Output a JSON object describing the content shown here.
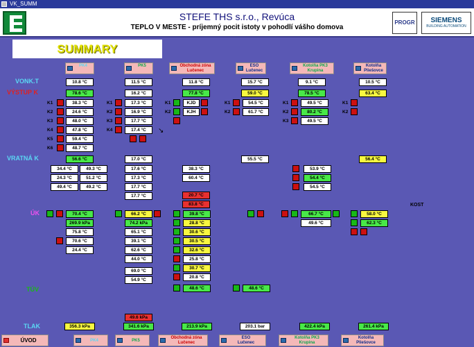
{
  "window": {
    "title": "VK_SUMM"
  },
  "header": {
    "company": "STEFE THS s.r.o., Revúca",
    "slogan": "TEPLO V MESTE - príjemný pocit istoty v pohodlí vášho domova",
    "progr": "PROGR",
    "siemens": "SIEMENS",
    "siemens_sub": "BUILDING AUTOMATION"
  },
  "summary": {
    "title": "SUMMARY"
  },
  "columns": [
    {
      "label": "PK4",
      "color": "#5ad8f4"
    },
    {
      "label": "PK5",
      "color": "#0aa84a"
    },
    {
      "label": "Obchodná zóna\nLučenec",
      "color": "#cc0000"
    },
    {
      "label": "ESO\nLučenec",
      "color": "#0a2a8a"
    },
    {
      "label": "Kotolňa PK3\nKrupina",
      "color": "#0aa84a"
    },
    {
      "label": "Kotolňa\nPliešovce",
      "color": "#0a2a8a"
    }
  ],
  "row_labels": {
    "vonk": "VONK.T",
    "vystup": "VÝSTUP K",
    "vratna": "VRATNÁ K",
    "uk": "ÚK",
    "tuv": "TÚV",
    "tlak": "TLAK"
  },
  "labels": {
    "k1": "K1",
    "k2": "K2",
    "k3": "K3",
    "k4": "K4",
    "k5": "K5",
    "k6": "K6",
    "kost": "KOST"
  },
  "values": {
    "vonk": [
      "10.8 °C",
      "11.5 °C",
      "11.8 °C",
      "15.7 °C",
      "9.1 °C",
      "10.5 °C"
    ],
    "vystup": [
      "78.6 °C",
      "16.2 °C",
      "77.8 °C",
      "59.0 °C",
      "78.5 °C",
      "63.4 °C"
    ],
    "pk4_k": [
      "38.3 °C",
      "24.6 °C",
      "48.0 °C",
      "47.8 °C",
      "59.4 °C",
      "48.7 °C"
    ],
    "pk5_k": [
      "17.3 °C",
      "16.9 °C",
      "17.7 °C",
      "17.4 °C"
    ],
    "oz_k": [
      "KJD",
      "KJH"
    ],
    "eso_k": [
      "54.5 °C",
      "61.7 °C"
    ],
    "krup_k": [
      "49.5 °C",
      "80.2 °C",
      "49.5 °C"
    ],
    "vratna": [
      "56.6 °C",
      "17.0 °C",
      "55.5 °C",
      "56.4 °C"
    ],
    "pk4_ret": [
      "34.4 °C",
      "49.3 °C",
      "24.3 °C",
      "51.2 °C",
      "49.4 °C",
      "49.2 °C"
    ],
    "pk5_ret": [
      "17.6 °C",
      "17.3 °C",
      "17.7 °C",
      "17.7 °C"
    ],
    "oz_ret": [
      "38.3 °C",
      "60.4 °C"
    ],
    "krup_ret": [
      "53.9 °C",
      "54.4 °C",
      "54.5 °C"
    ],
    "oz_alarm": [
      "20.7 °C",
      "83.8 °C"
    ],
    "uk_pk4": [
      "70.4 °C",
      "269.9 kPa",
      "75.8 °C",
      "70.6 °C",
      "24.4 °C"
    ],
    "uk_pk5": [
      "66.2 °C",
      "74.2 kPa",
      "65.1 °C",
      "39.1 °C",
      "62.6 °C",
      "44.0 °C",
      "69.0 °C",
      "54.9 °C"
    ],
    "uk_oz": [
      "39.8 °C",
      "28.8 °C",
      "30.6 °C",
      "30.5 °C",
      "32.6 °C",
      "25.8 °C",
      "30.7 °C",
      "20.8 °C"
    ],
    "uk_krup": [
      "66.7 °C",
      "49.6 °C"
    ],
    "uk_plie": [
      "58.0 °C",
      "62.3 °C"
    ],
    "tuv": [
      "48.6 °C",
      "48.6 °C"
    ],
    "pk5_alarm": "49.6 kPa",
    "tlak": [
      "356.3 kPa",
      "341.6 kPa",
      "213.9 kPa",
      "203.1 bar",
      "422.4 kPa",
      "261.4 kPa"
    ]
  },
  "nav": {
    "uvod": "ÚVOD",
    "pk4": "PK4",
    "pk5": "PK5",
    "oz": "Obchodná zóna\nLučenec",
    "eso": "ESO\nLučenec",
    "krup": "Kotolňa PK3\nKrupina",
    "plie": "Kotolňa\nPliešovce"
  },
  "colors": {
    "background": "#5a58b4",
    "white": "#ffffff",
    "green": "#48e848",
    "yellow": "#f8f840",
    "red": "#e83030"
  }
}
